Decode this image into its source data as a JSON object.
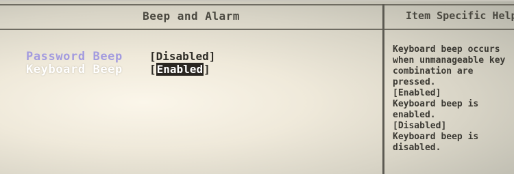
{
  "header": {
    "title": "Beep and Alarm"
  },
  "help_panel": {
    "title": "Item Specific Help",
    "lines": [
      "Keyboard beep occurs",
      "when unmanageable key",
      "combination are",
      "pressed.",
      "[Enabled]",
      "Keyboard beep is",
      "enabled.",
      "[Disabled]",
      "Keyboard beep is",
      "disabled."
    ]
  },
  "settings": [
    {
      "label": "Password Beep",
      "value": "Disabled",
      "selected": false
    },
    {
      "label": "Keyboard Beep",
      "value": "Enabled",
      "selected": true
    }
  ],
  "colors": {
    "inactive_label": "#a39bdf",
    "selected_label": "#ffffff",
    "selected_value_bg": "#2a2621"
  }
}
